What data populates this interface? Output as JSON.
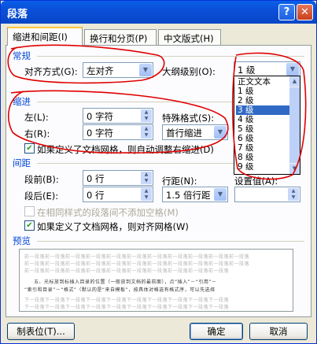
{
  "window": {
    "title": "段落",
    "help_button": "?",
    "close_button": "✕"
  },
  "tabs": [
    {
      "label": "缩进和间距(I)",
      "active": true
    },
    {
      "label": "换行和分页(P)",
      "active": false
    },
    {
      "label": "中文版式(H)",
      "active": false
    }
  ],
  "general": {
    "section_label": "常规",
    "alignment_label": "对齐方式(G):",
    "alignment_value": "左对齐",
    "outline_label": "大纲级别(O):",
    "outline_value": "1 级",
    "outline_options": [
      "正文文本",
      "1 级",
      "2 级",
      "3 级",
      "4 级",
      "5 级",
      "6 级",
      "7 级",
      "8 级",
      "9 级"
    ],
    "outline_selected_option": "3 级"
  },
  "indent": {
    "section_label": "缩进",
    "left_label": "左(L):",
    "left_value": "0 字符",
    "right_label": "右(R):",
    "right_value": "0 字符",
    "special_label": "特殊格式(S):",
    "special_value": "首行缩进",
    "auto_adjust_label": "如果定义了文档网格，则自动调整右缩进(D)",
    "auto_adjust_checked": true
  },
  "spacing": {
    "section_label": "间距",
    "before_label": "段前(B):",
    "before_value": "0 行",
    "after_label": "段后(E):",
    "after_value": "0 行",
    "line_spacing_label": "行距(N):",
    "line_spacing_value": "1.5 倍行距",
    "setting_label": "设置值(A):",
    "setting_value": "",
    "no_space_label": "在相同样式的段落间不添加空格(M)",
    "no_space_checked": false,
    "snap_grid_label": "如果定义了文档网格，则对齐网格(W)",
    "snap_grid_checked": true
  },
  "preview": {
    "section_label": "预览",
    "lines": [
      "前一段落前一段落前一段落前一段落前一段落前一段落前一段落前一段落前一段落前一段落前一段落",
      "前一段落前一段落前一段落前一段落前一段落前一段落前一段落前一段落前一段落前一段落前一段落",
      "前一段落前一段落前一段落前一段落前一段落前一段落前一段落前一段落前一段落前一段落",
      "五、光标放到标插入目录的位置（一般放到文档的最前面），点“插入”－“引用”－",
      "“索引和目录”－“格式”（默认的是“来自模板”，按具体对格选有格式序，可以先选择",
      "下一段落下一段落下一段落下一段落下一段落下一段落下一段落下一段落下一段落下一段落",
      "下一段落下一段落下一段落下一段落下一段落下一段落下一段落下一段落下一段落下一段落"
    ]
  },
  "buttons": {
    "tabs": "制表位(T)...",
    "ok": "确定",
    "cancel": "取消"
  },
  "colors": {
    "section_title": "#0046d5",
    "dialog_bg": "#ece9d8",
    "annotation": "#e00000",
    "selection": "#316ac5"
  }
}
